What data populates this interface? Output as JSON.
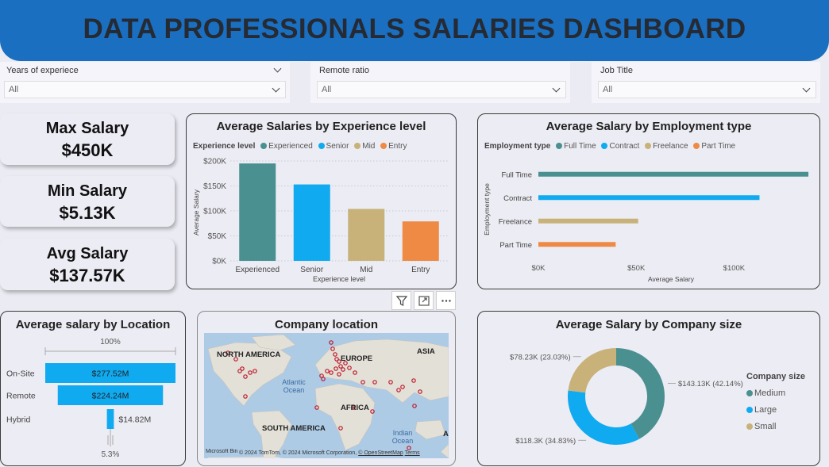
{
  "header": {
    "title": "DATA PROFESSIONALS SALARIES DASHBOARD"
  },
  "slicers": [
    {
      "label": "Years of experiece",
      "value": "All"
    },
    {
      "label": "Remote ratio",
      "value": "All"
    },
    {
      "label": "Job Title",
      "value": "All"
    }
  ],
  "kpis": [
    {
      "title": "Max Salary",
      "value": "$450K"
    },
    {
      "title": "Min Salary",
      "value": "$5.13K"
    },
    {
      "title": "Avg Salary",
      "value": "$137.57K"
    }
  ],
  "experience_card": {
    "title": "Average Salaries by Experience level",
    "legend_title": "Experience level",
    "legend": [
      "Experienced",
      "Senior",
      "Mid",
      "Entry"
    ],
    "colors": [
      "#4a9090",
      "#10aaf0",
      "#c8b27a",
      "#ef8a45"
    ]
  },
  "employment_card": {
    "title": "Average Salary by Employment type",
    "legend_title": "Employment type",
    "legend": [
      "Full Time",
      "Contract",
      "Freelance",
      "Part Time"
    ],
    "colors": [
      "#4a9090",
      "#10aaf0",
      "#c8b27a",
      "#ef8a45"
    ]
  },
  "location_card": {
    "title": "Average salary by Location",
    "top_pct": "100%",
    "bottom_pct": "5.3%",
    "bar_color": "#10aaf0"
  },
  "map_card": {
    "title": "Company location",
    "labels": {
      "north_america": "NORTH AMERICA",
      "europe": "EUROPE",
      "asia": "ASIA",
      "africa": "AFRICA",
      "south_america": "SOUTH AMERICA",
      "atlantic": "Atlantic Ocean",
      "indian": "Indian Ocean",
      "edge": "A"
    },
    "attribution": "© 2024 TomTom, © 2024 Microsoft Corporation,",
    "attribution_link1": "© OpenStreetMap",
    "attribution_link2": "Terms",
    "logo": "Microsoft Bing"
  },
  "size_card": {
    "title": "Average Salary by Company size",
    "legend_title": "Company size",
    "legend": [
      "Medium",
      "Large",
      "Small"
    ],
    "colors": [
      "#4a9090",
      "#10aaf0",
      "#c8b27a"
    ]
  },
  "toolbar": {
    "icons": [
      "filter-icon",
      "focus-mode-icon",
      "more-options-icon"
    ]
  },
  "chart_data": [
    {
      "type": "bar",
      "title": "Average Salaries by Experience level",
      "categories": [
        "Experienced",
        "Senior",
        "Mid",
        "Entry"
      ],
      "values": [
        195000,
        153000,
        104000,
        79000
      ],
      "xlabel": "Experience level",
      "ylabel": "Average Salary",
      "ylim": [
        0,
        200000
      ],
      "yticks": [
        "$0K",
        "$50K",
        "$100K",
        "$150K",
        "$200K"
      ],
      "grid": true,
      "legend": "top-left"
    },
    {
      "type": "bar",
      "orientation": "horizontal",
      "title": "Average Salary by Employment type",
      "categories": [
        "Full Time",
        "Contract",
        "Freelance",
        "Part Time"
      ],
      "values": [
        138000,
        113000,
        51000,
        39500
      ],
      "xlabel": "Average Salary",
      "ylabel": "Employment type",
      "xlim": [
        0,
        140000
      ],
      "xticks": [
        "$0K",
        "$50K",
        "$100K"
      ],
      "grid": false,
      "legend": "top-left"
    },
    {
      "type": "bar",
      "subtype": "funnel",
      "title": "Average salary by Location",
      "categories": [
        "On-Site",
        "Remote",
        "Hybrid"
      ],
      "values": [
        277.52,
        224.24,
        14.82
      ],
      "labels": [
        "$277.52M",
        "$224.24M",
        "$14.82M"
      ],
      "unit": "M"
    },
    {
      "type": "scatter",
      "subtype": "map",
      "title": "Company location",
      "note": "location points only; no values printed"
    },
    {
      "type": "pie",
      "subtype": "donut",
      "title": "Average Salary by Company size",
      "categories": [
        "Medium",
        "Large",
        "Small"
      ],
      "values": [
        143.13,
        118.3,
        78.23
      ],
      "percentages": [
        42.14,
        34.83,
        23.03
      ],
      "labels": [
        "$143.13K (42.14%)",
        "$118.3K (34.83%)",
        "$78.23K (23.03%)"
      ],
      "legend": "right"
    }
  ]
}
